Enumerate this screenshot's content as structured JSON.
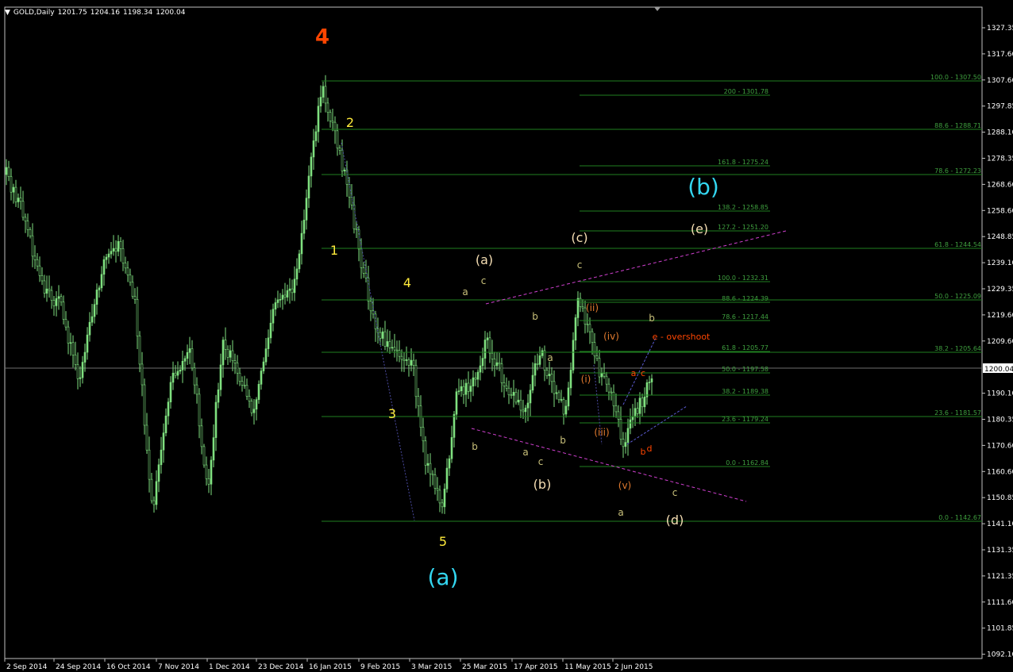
{
  "header": {
    "menu_arrow": "▼",
    "symbol": "GOLD,Daily",
    "open": "1201.75",
    "high": "1204.16",
    "low": "1198.34",
    "close": "1200.04"
  },
  "price_axis": {
    "labels": [
      "1327.35",
      "1317.60",
      "1307.60",
      "1297.85",
      "1288.10",
      "1278.35",
      "1268.60",
      "1258.60",
      "1248.85",
      "1239.10",
      "1229.35",
      "1219.60",
      "1209.60",
      "1200.04",
      "1190.10",
      "1180.35",
      "1170.60",
      "1160.60",
      "1150.85",
      "1141.10",
      "1131.35",
      "1121.35",
      "1111.60",
      "1101.85",
      "1092.10"
    ],
    "current_price": "1200.04"
  },
  "time_axis": {
    "labels": [
      "2 Sep 2014",
      "24 Sep 2014",
      "16 Oct 2014",
      "7 Nov 2014",
      "1 Dec 2014",
      "23 Dec 2014",
      "16 Jan 2015",
      "9 Feb 2015",
      "3 Mar 2015",
      "25 Mar 2015",
      "17 Apr 2015",
      "11 May 2015",
      "2 Jun 2015"
    ]
  },
  "fib_levels": [
    {
      "label": "100.0 - 1307.50"
    },
    {
      "label": "200 - 1301.78"
    },
    {
      "label": "88.6 - 1288.71"
    },
    {
      "label": "161.8 - 1275.24"
    },
    {
      "label": "78.6 - 1272.23"
    },
    {
      "label": "138.2 - 1258.85"
    },
    {
      "label": "127.2 - 1251.20"
    },
    {
      "label": "61.8 - 1244.54"
    },
    {
      "label": "100.0 - 1232.31"
    },
    {
      "label": "88.6 - 1224.39"
    },
    {
      "label": "50.0 - 1225.09"
    },
    {
      "label": "78.6 - 1217.44"
    },
    {
      "label": "61.8 - 1205.77"
    },
    {
      "label": "38.2 - 1205.64"
    },
    {
      "label": "50.0 - 1197.58"
    },
    {
      "label": "38.2 - 1189.38"
    },
    {
      "label": "23.6 - 1181.57"
    },
    {
      "label": "23.6 - 1179.24"
    },
    {
      "label": "0.0 - 1162.84"
    },
    {
      "label": "0.0 - 1142.67"
    }
  ],
  "wave_labels": [
    {
      "text": "4"
    },
    {
      "text": "2"
    },
    {
      "text": "1"
    },
    {
      "text": "4"
    },
    {
      "text": "3"
    },
    {
      "text": "5"
    },
    {
      "text": "(a)"
    },
    {
      "text": "(b)"
    },
    {
      "text": "(e)"
    },
    {
      "text": "(a)"
    },
    {
      "text": "(c)"
    },
    {
      "text": "(b)"
    },
    {
      "text": "(d)"
    },
    {
      "text": "a"
    },
    {
      "text": "c"
    },
    {
      "text": "c"
    },
    {
      "text": "b"
    },
    {
      "text": "a"
    },
    {
      "text": "b"
    },
    {
      "text": "a"
    },
    {
      "text": "c"
    },
    {
      "text": "b"
    },
    {
      "text": "b"
    },
    {
      "text": "a"
    },
    {
      "text": "c"
    },
    {
      "text": "(ii)"
    },
    {
      "text": "(iv)"
    },
    {
      "text": "(i)"
    },
    {
      "text": "(iii)"
    },
    {
      "text": "(v)"
    },
    {
      "text": "e - overshoot"
    },
    {
      "text": "a"
    },
    {
      "text": "c"
    },
    {
      "text": "b"
    },
    {
      "text": "d"
    }
  ],
  "colors": {
    "background": "#000000",
    "candle": "#7fe07f",
    "grid_line": "#1f7f1f",
    "fib_text": "#3fa03f",
    "trendline": "#d040d0",
    "wave_red": "#ff4500",
    "wave_yellow": "#ffeb3b",
    "wave_cyan": "#33d6f0",
    "wave_beige": "#f5deb3",
    "wave_khaki": "#c8c07a",
    "wave_orange": "#e07a2e",
    "axis_text": "#ffffff"
  }
}
